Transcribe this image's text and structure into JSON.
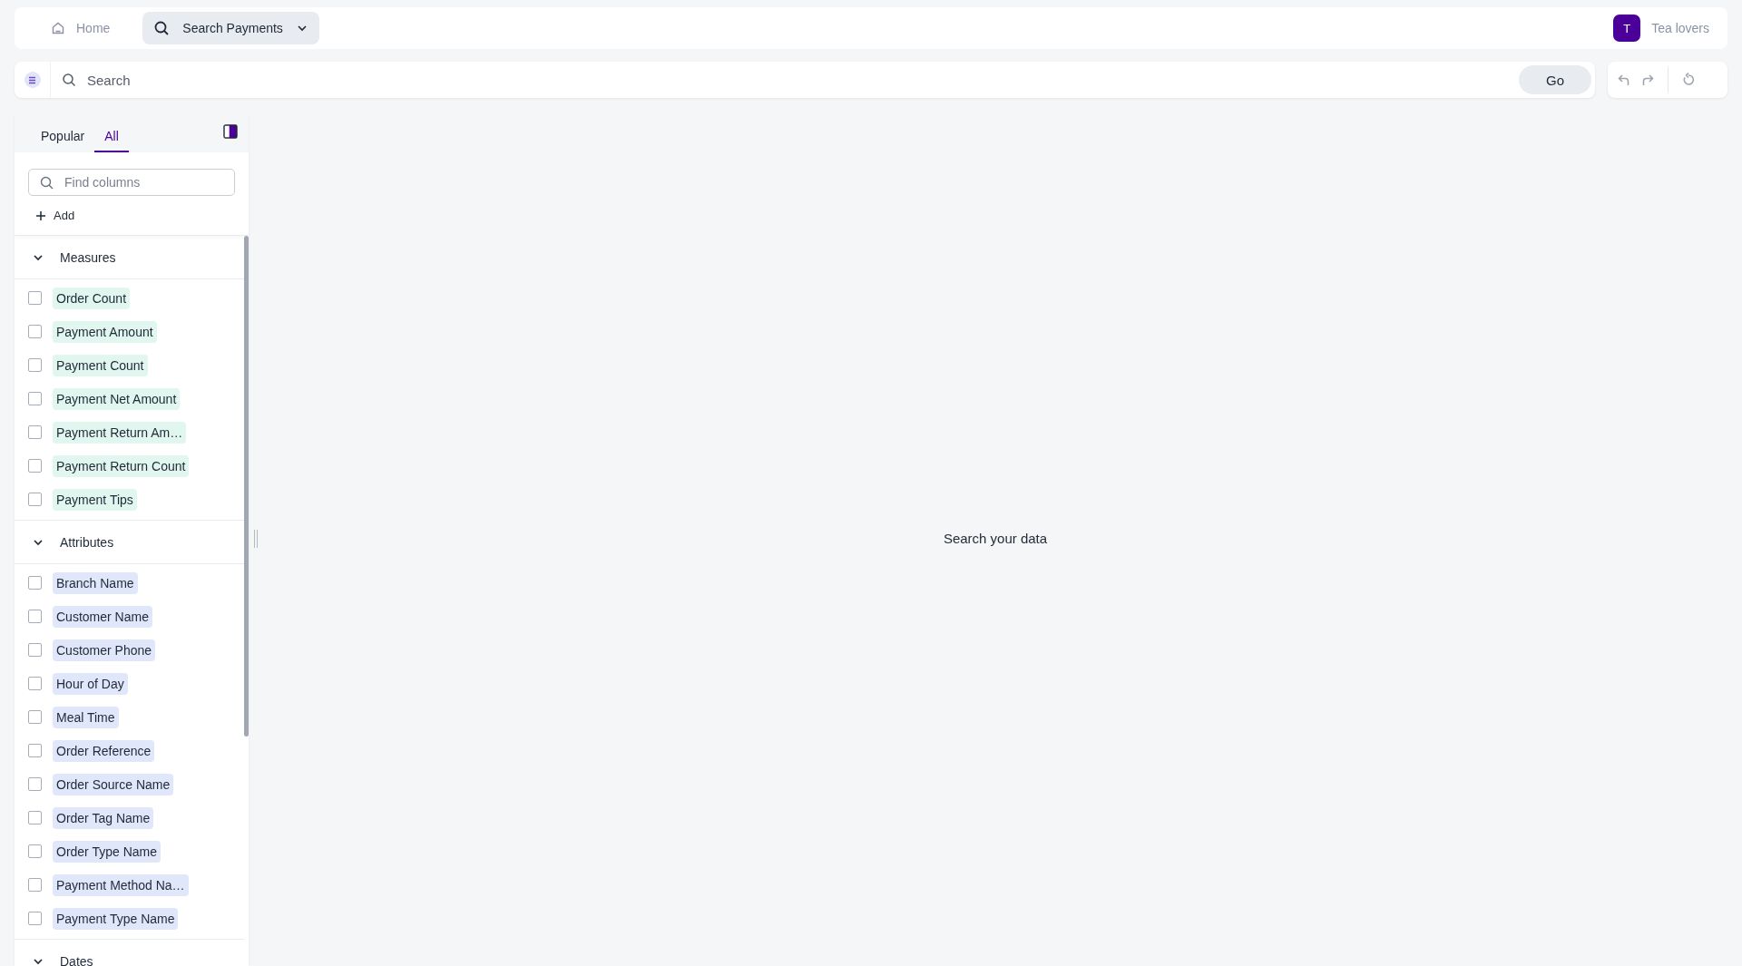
{
  "top_bar": {
    "home": "Home",
    "search_tab": "Search Payments",
    "org_initial": "T",
    "org_name": "Tea lovers"
  },
  "search_bar": {
    "placeholder": "Search",
    "go": "Go"
  },
  "panel": {
    "tabs": [
      {
        "label": "Popular",
        "selected": false
      },
      {
        "label": "All",
        "selected": true
      }
    ],
    "find": {
      "placeholder": "Find columns"
    },
    "add": "Add",
    "sections": [
      {
        "title": "Measures",
        "kind": "measure",
        "expanded": true,
        "items": [
          {
            "label": "Order Count",
            "checked": false
          },
          {
            "label": "Payment Amount",
            "checked": false
          },
          {
            "label": "Payment Count",
            "checked": false
          },
          {
            "label": "Payment Net Amount",
            "checked": false
          },
          {
            "label": "Payment Return Am…",
            "checked": false
          },
          {
            "label": "Payment Return Count",
            "checked": false
          },
          {
            "label": "Payment Tips",
            "checked": false
          }
        ]
      },
      {
        "title": "Attributes",
        "kind": "attribute",
        "expanded": true,
        "items": [
          {
            "label": "Branch Name",
            "checked": false
          },
          {
            "label": "Customer Name",
            "checked": false
          },
          {
            "label": "Customer Phone",
            "checked": false
          },
          {
            "label": "Hour of Day",
            "checked": false
          },
          {
            "label": "Meal Time",
            "checked": false
          },
          {
            "label": "Order Reference",
            "checked": false
          },
          {
            "label": "Order Source Name",
            "checked": false
          },
          {
            "label": "Order Tag Name",
            "checked": false
          },
          {
            "label": "Order Type Name",
            "checked": false
          },
          {
            "label": "Payment Method Na…",
            "checked": false
          },
          {
            "label": "Payment Type Name",
            "checked": false
          }
        ]
      },
      {
        "title": "Dates",
        "expanded": true
      }
    ]
  },
  "main": {
    "message": "Search your data"
  }
}
